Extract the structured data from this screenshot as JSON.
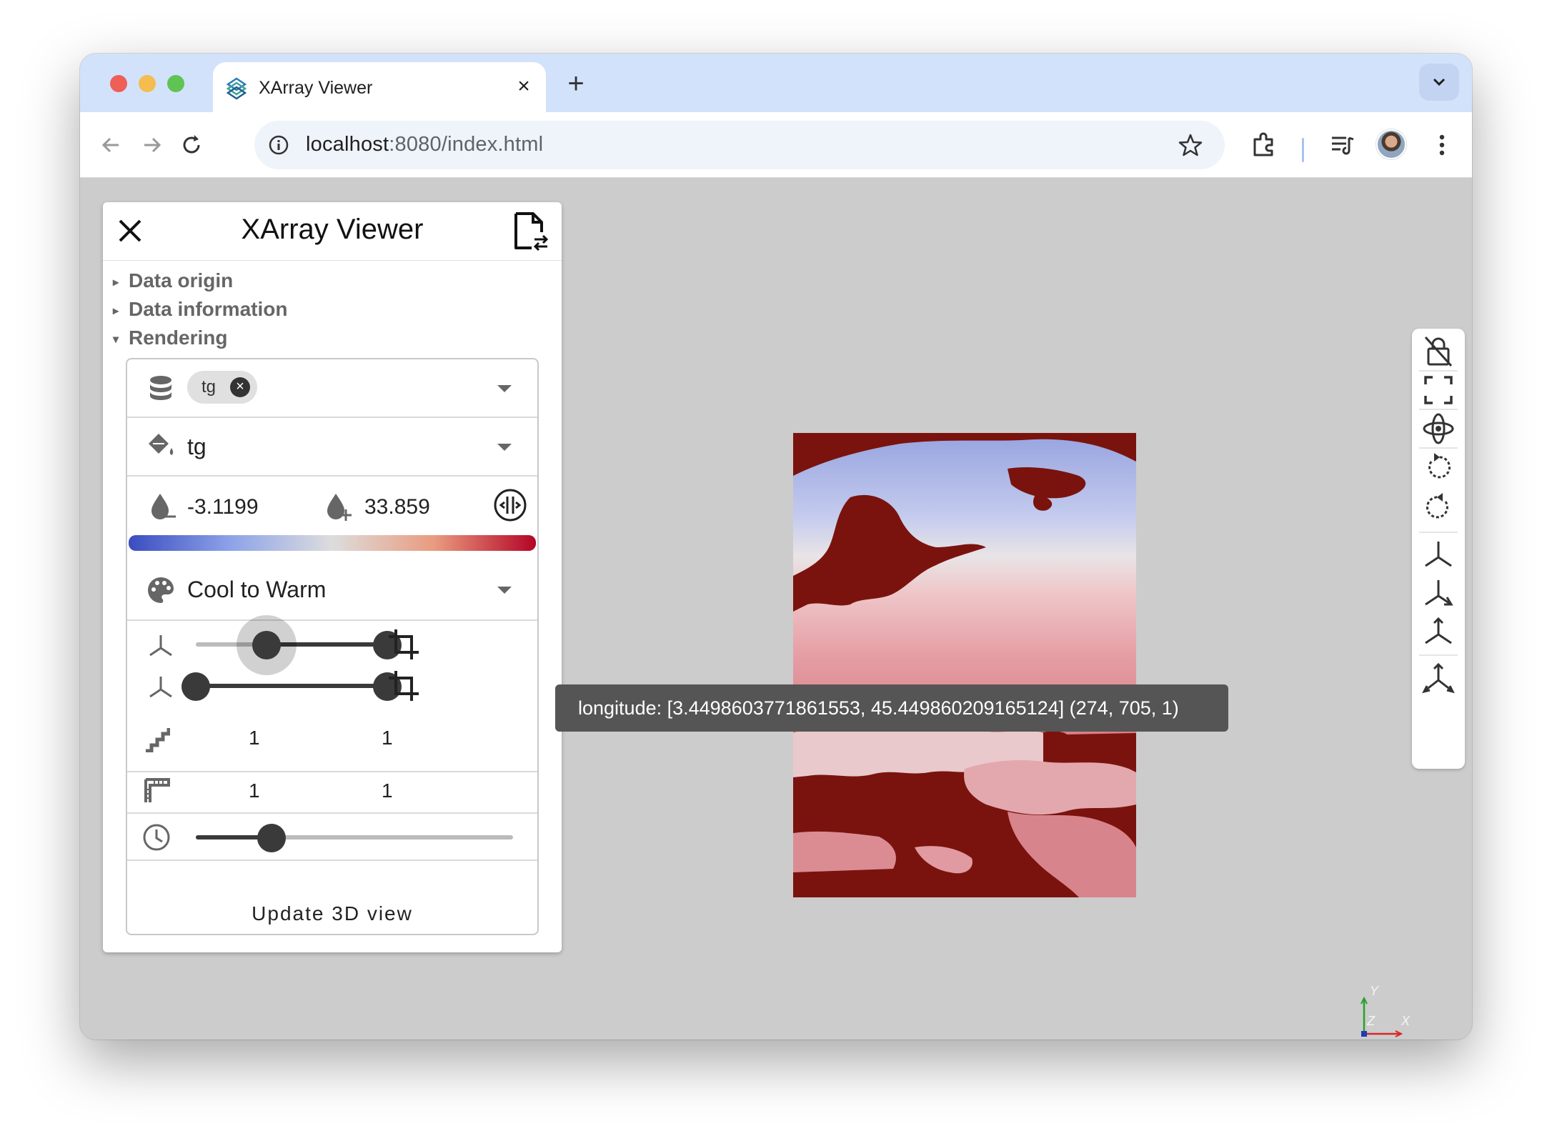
{
  "browser": {
    "tab_title": "XArray Viewer",
    "tab_close": "×",
    "new_tab": "+",
    "url_host": "localhost",
    "url_rest": ":8080/index.html"
  },
  "panel": {
    "title": "XArray Viewer",
    "sections": [
      {
        "label": "Data origin",
        "expanded": false
      },
      {
        "label": "Data information",
        "expanded": false
      },
      {
        "label": "Rendering",
        "expanded": true
      }
    ],
    "rendering": {
      "variables_chip": "tg",
      "chip_remove": "×",
      "color_by": "tg",
      "range_min": "-3.1199",
      "range_max": "33.859",
      "colormap": "Cool to Warm",
      "slice_x_lower": 0.37,
      "slice_x_upper": 1.0,
      "slice_y_lower": 0.0,
      "slice_y_upper": 1.0,
      "step_x": "1",
      "step_y": "1",
      "scale_x": "1",
      "scale_y": "1",
      "time_position": 0.33,
      "update_label": "Update 3D view"
    }
  },
  "tooltip": {
    "text": "longitude: [3.4498603771861553, 45.449860209165124] (274, 705, 1)"
  },
  "gizmo": {
    "x_label": "X",
    "y_label": "Y",
    "z_label": "Z"
  },
  "colors": {
    "ocean": "#7a130e",
    "cool": "#3b4cc0",
    "warm": "#b40426",
    "tab_bar": "#d3e2fb"
  }
}
